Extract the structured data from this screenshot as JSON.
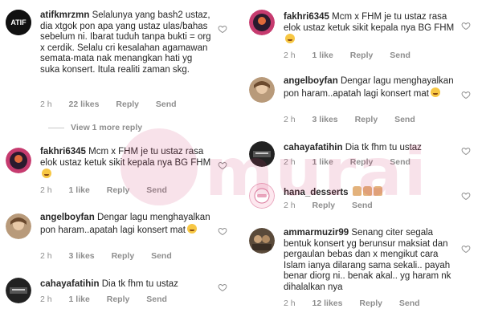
{
  "left": {
    "comments": [
      {
        "username": "atifkmrzmn",
        "avatar_text": "ATIF",
        "text": "Selalunya yang bash2 ustaz, dia xtgok pon apa yang ustaz ulas/bahas sebelum ni. Ibarat tuduh tanpa bukti = org x cerdik. Selalu cri kesalahan agamawan semata-mata nak menangkan hati yg suka konsert. Itula realiti zaman skg.",
        "time": "2 h",
        "likes": "22 likes",
        "reply": "Reply",
        "send": "Send"
      },
      {
        "username": "fakhri6345",
        "text": "Mcm x FHM je tu ustaz rasa elok ustaz ketuk sikit kepala nya BG FHM",
        "time": "2 h",
        "likes": "1 like",
        "reply": "Reply",
        "send": "Send"
      },
      {
        "username": "angelboyfan",
        "text": "Dengar lagu menghayalkan pon haram..apatah lagi konsert mat",
        "time": "2 h",
        "likes": "3 likes",
        "reply": "Reply",
        "send": "Send"
      },
      {
        "username": "cahayafatihin",
        "text": "Dia tk fhm tu ustaz",
        "time": "2 h",
        "likes": "1 like",
        "reply": "Reply",
        "send": "Send"
      }
    ],
    "view_more": "View 1 more reply"
  },
  "right": {
    "comments": [
      {
        "username": "fakhri6345",
        "text": "Mcm x FHM je tu ustaz rasa elok ustaz ketuk sikit kepala nya BG FHM",
        "time": "2 h",
        "likes": "1 like",
        "reply": "Reply",
        "send": "Send"
      },
      {
        "username": "angelboyfan",
        "text": "Dengar lagu menghayalkan pon haram..apatah lagi konsert mat",
        "time": "2 h",
        "likes": "3 likes",
        "reply": "Reply",
        "send": "Send"
      },
      {
        "username": "cahayafatihin",
        "text": "Dia tk fhm tu ustaz",
        "time": "2 h",
        "likes": "1 like",
        "reply": "Reply",
        "send": "Send"
      },
      {
        "username": "hana_desserts",
        "text": "",
        "time": "2 h",
        "likes": "",
        "reply": "Reply",
        "send": "Send"
      },
      {
        "username": "ammarmuzir99",
        "text": "Senang citer segala bentuk konsert yg berunsur maksiat dan pergaulan bebas dan x mengikut cara Islam ianya dilarang sama sekali.. payah benar diorg ni.. benak akal.. yg haram nk dihalalkan nya",
        "time": "2 h",
        "likes": "12 likes",
        "reply": "Reply",
        "send": "Send"
      }
    ]
  },
  "watermark": "murai",
  "colors": {
    "meta": "#8e8e8e",
    "text": "#262626",
    "watermark": "#d33a6e"
  }
}
